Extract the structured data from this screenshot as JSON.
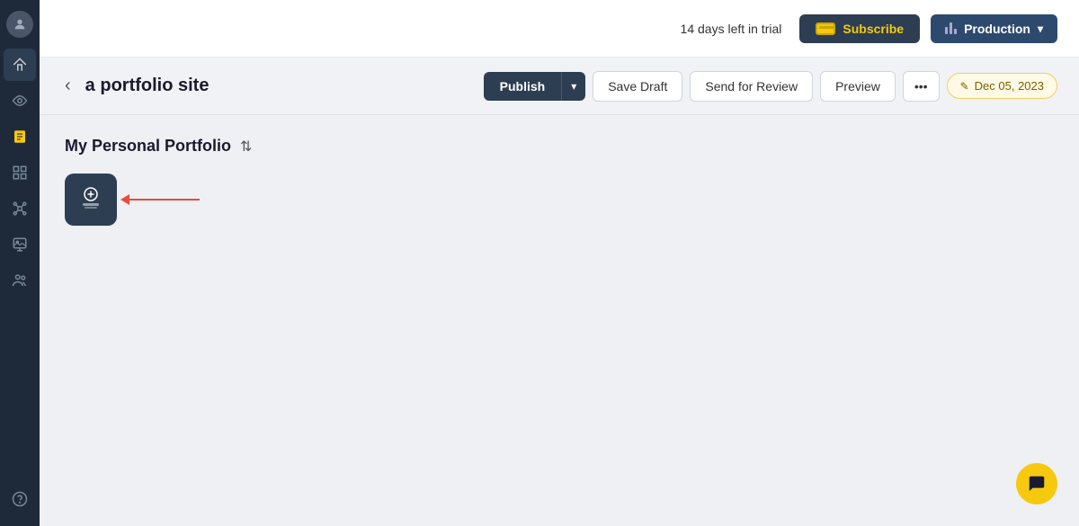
{
  "header": {
    "trial_text": "14 days left in trial",
    "subscribe_label": "Subscribe",
    "production_label": "Production",
    "chevron_down": "▾"
  },
  "content_header": {
    "back_icon": "‹",
    "page_title": "a portfolio site",
    "publish_label": "Publish",
    "publish_dropdown_icon": "▾",
    "save_draft_label": "Save Draft",
    "send_review_label": "Send for Review",
    "preview_label": "Preview",
    "more_icon": "•••",
    "date_label": "Dec 05, 2023",
    "date_pencil_icon": "✎"
  },
  "content": {
    "portfolio_title": "My Personal Portfolio",
    "toggle_icon": "⇅"
  },
  "sidebar": {
    "items": [
      {
        "name": "home",
        "icon": "⌂"
      },
      {
        "name": "blog",
        "icon": "✎"
      },
      {
        "name": "pages",
        "icon": "▣"
      },
      {
        "name": "grid",
        "icon": "⊞"
      },
      {
        "name": "integrations",
        "icon": "⚙"
      },
      {
        "name": "media",
        "icon": "🖼"
      },
      {
        "name": "users",
        "icon": "👥"
      }
    ],
    "help_icon": "?"
  }
}
